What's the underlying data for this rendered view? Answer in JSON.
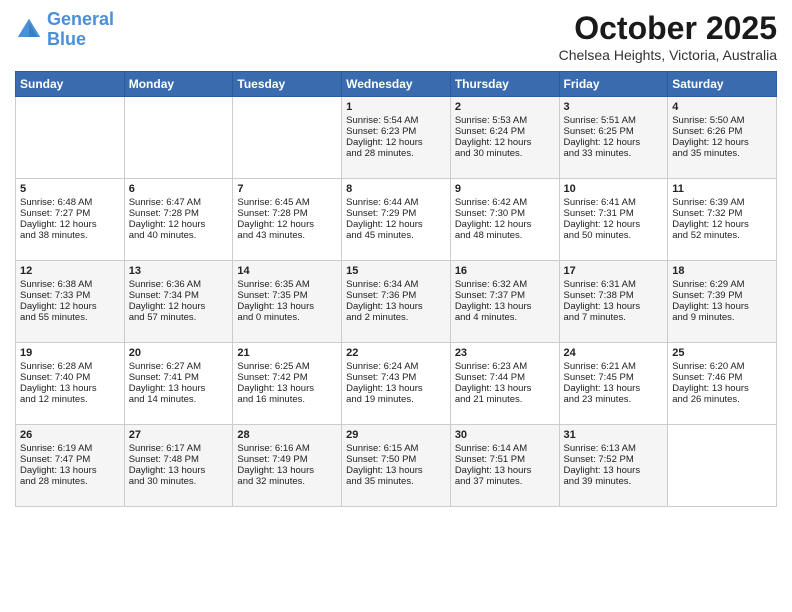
{
  "header": {
    "logo_line1": "General",
    "logo_line2": "Blue",
    "month": "October 2025",
    "location": "Chelsea Heights, Victoria, Australia"
  },
  "days_of_week": [
    "Sunday",
    "Monday",
    "Tuesday",
    "Wednesday",
    "Thursday",
    "Friday",
    "Saturday"
  ],
  "weeks": [
    [
      {
        "day": "",
        "content": ""
      },
      {
        "day": "",
        "content": ""
      },
      {
        "day": "",
        "content": ""
      },
      {
        "day": "1",
        "content": "Sunrise: 5:54 AM\nSunset: 6:23 PM\nDaylight: 12 hours\nand 28 minutes."
      },
      {
        "day": "2",
        "content": "Sunrise: 5:53 AM\nSunset: 6:24 PM\nDaylight: 12 hours\nand 30 minutes."
      },
      {
        "day": "3",
        "content": "Sunrise: 5:51 AM\nSunset: 6:25 PM\nDaylight: 12 hours\nand 33 minutes."
      },
      {
        "day": "4",
        "content": "Sunrise: 5:50 AM\nSunset: 6:26 PM\nDaylight: 12 hours\nand 35 minutes."
      }
    ],
    [
      {
        "day": "5",
        "content": "Sunrise: 6:48 AM\nSunset: 7:27 PM\nDaylight: 12 hours\nand 38 minutes."
      },
      {
        "day": "6",
        "content": "Sunrise: 6:47 AM\nSunset: 7:28 PM\nDaylight: 12 hours\nand 40 minutes."
      },
      {
        "day": "7",
        "content": "Sunrise: 6:45 AM\nSunset: 7:28 PM\nDaylight: 12 hours\nand 43 minutes."
      },
      {
        "day": "8",
        "content": "Sunrise: 6:44 AM\nSunset: 7:29 PM\nDaylight: 12 hours\nand 45 minutes."
      },
      {
        "day": "9",
        "content": "Sunrise: 6:42 AM\nSunset: 7:30 PM\nDaylight: 12 hours\nand 48 minutes."
      },
      {
        "day": "10",
        "content": "Sunrise: 6:41 AM\nSunset: 7:31 PM\nDaylight: 12 hours\nand 50 minutes."
      },
      {
        "day": "11",
        "content": "Sunrise: 6:39 AM\nSunset: 7:32 PM\nDaylight: 12 hours\nand 52 minutes."
      }
    ],
    [
      {
        "day": "12",
        "content": "Sunrise: 6:38 AM\nSunset: 7:33 PM\nDaylight: 12 hours\nand 55 minutes."
      },
      {
        "day": "13",
        "content": "Sunrise: 6:36 AM\nSunset: 7:34 PM\nDaylight: 12 hours\nand 57 minutes."
      },
      {
        "day": "14",
        "content": "Sunrise: 6:35 AM\nSunset: 7:35 PM\nDaylight: 13 hours\nand 0 minutes."
      },
      {
        "day": "15",
        "content": "Sunrise: 6:34 AM\nSunset: 7:36 PM\nDaylight: 13 hours\nand 2 minutes."
      },
      {
        "day": "16",
        "content": "Sunrise: 6:32 AM\nSunset: 7:37 PM\nDaylight: 13 hours\nand 4 minutes."
      },
      {
        "day": "17",
        "content": "Sunrise: 6:31 AM\nSunset: 7:38 PM\nDaylight: 13 hours\nand 7 minutes."
      },
      {
        "day": "18",
        "content": "Sunrise: 6:29 AM\nSunset: 7:39 PM\nDaylight: 13 hours\nand 9 minutes."
      }
    ],
    [
      {
        "day": "19",
        "content": "Sunrise: 6:28 AM\nSunset: 7:40 PM\nDaylight: 13 hours\nand 12 minutes."
      },
      {
        "day": "20",
        "content": "Sunrise: 6:27 AM\nSunset: 7:41 PM\nDaylight: 13 hours\nand 14 minutes."
      },
      {
        "day": "21",
        "content": "Sunrise: 6:25 AM\nSunset: 7:42 PM\nDaylight: 13 hours\nand 16 minutes."
      },
      {
        "day": "22",
        "content": "Sunrise: 6:24 AM\nSunset: 7:43 PM\nDaylight: 13 hours\nand 19 minutes."
      },
      {
        "day": "23",
        "content": "Sunrise: 6:23 AM\nSunset: 7:44 PM\nDaylight: 13 hours\nand 21 minutes."
      },
      {
        "day": "24",
        "content": "Sunrise: 6:21 AM\nSunset: 7:45 PM\nDaylight: 13 hours\nand 23 minutes."
      },
      {
        "day": "25",
        "content": "Sunrise: 6:20 AM\nSunset: 7:46 PM\nDaylight: 13 hours\nand 26 minutes."
      }
    ],
    [
      {
        "day": "26",
        "content": "Sunrise: 6:19 AM\nSunset: 7:47 PM\nDaylight: 13 hours\nand 28 minutes."
      },
      {
        "day": "27",
        "content": "Sunrise: 6:17 AM\nSunset: 7:48 PM\nDaylight: 13 hours\nand 30 minutes."
      },
      {
        "day": "28",
        "content": "Sunrise: 6:16 AM\nSunset: 7:49 PM\nDaylight: 13 hours\nand 32 minutes."
      },
      {
        "day": "29",
        "content": "Sunrise: 6:15 AM\nSunset: 7:50 PM\nDaylight: 13 hours\nand 35 minutes."
      },
      {
        "day": "30",
        "content": "Sunrise: 6:14 AM\nSunset: 7:51 PM\nDaylight: 13 hours\nand 37 minutes."
      },
      {
        "day": "31",
        "content": "Sunrise: 6:13 AM\nSunset: 7:52 PM\nDaylight: 13 hours\nand 39 minutes."
      },
      {
        "day": "",
        "content": ""
      }
    ]
  ]
}
